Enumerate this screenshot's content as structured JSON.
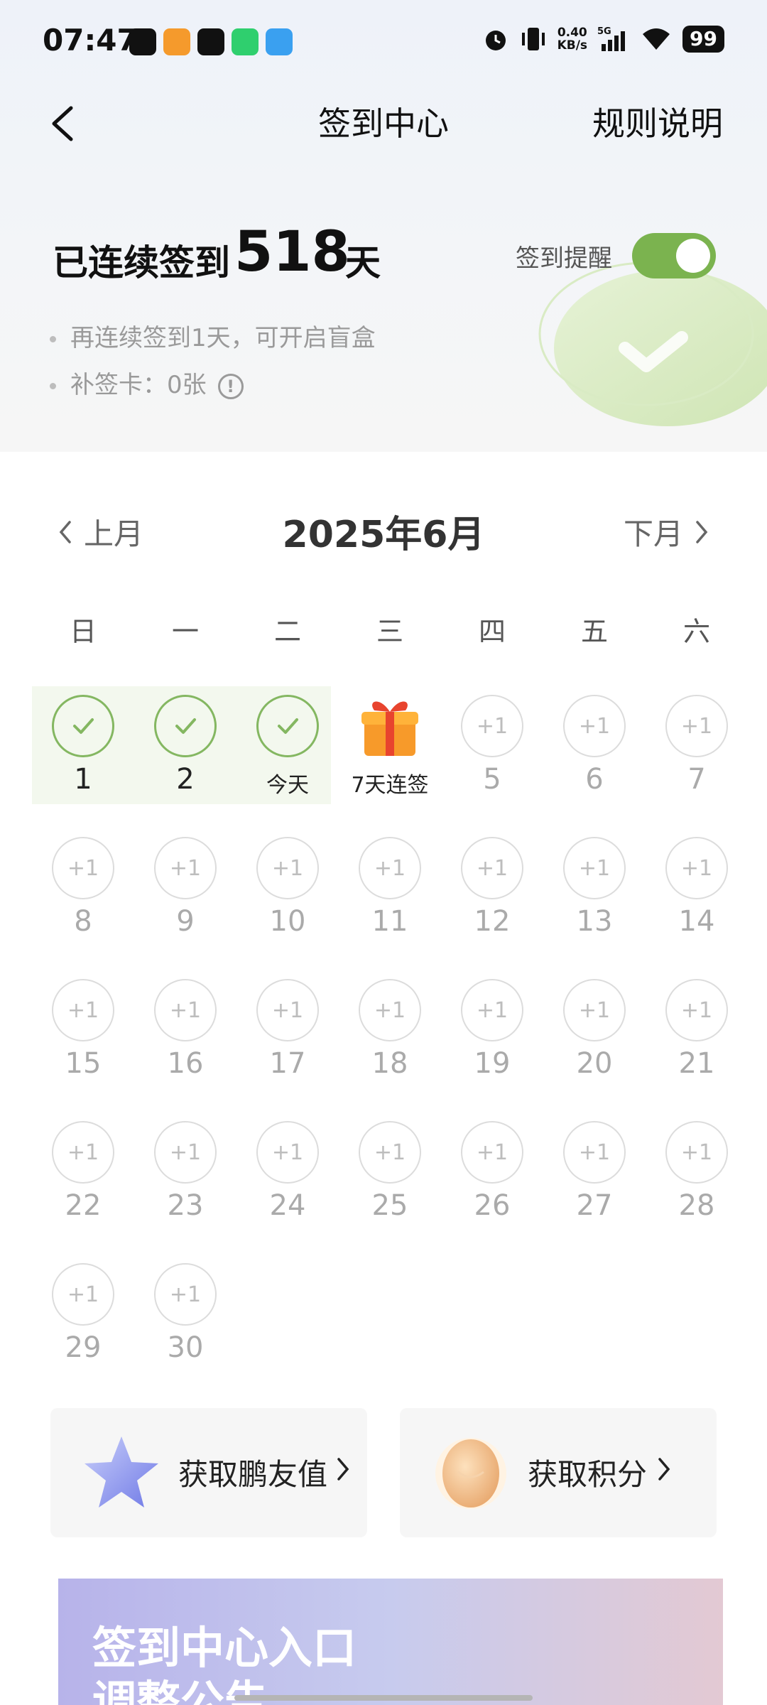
{
  "status_bar": {
    "time": "07:47",
    "net_speed_value": "0.40",
    "net_speed_unit": "KB/s",
    "network": "5G",
    "battery": "99"
  },
  "nav": {
    "title": "签到中心",
    "rules_label": "规则说明"
  },
  "summary": {
    "streak_label": "已连续签到",
    "streak_days": "518",
    "streak_unit": "天",
    "reminder_label": "签到提醒",
    "reminder_on": true,
    "hint_next": "再连续签到1天，可开启盲盒",
    "hint_card": "补签卡：0张"
  },
  "calendar": {
    "prev_label": "上月",
    "month_title": "2025年6月",
    "next_label": "下月",
    "weekdays": [
      "日",
      "一",
      "二",
      "三",
      "四",
      "五",
      "六"
    ],
    "plus_label": "+1",
    "days": [
      {
        "label": "1",
        "state": "signed"
      },
      {
        "label": "2",
        "state": "signed"
      },
      {
        "label": "今天",
        "state": "signed-today"
      },
      {
        "label": "7天连签",
        "state": "gift"
      },
      {
        "label": "5",
        "state": "pending"
      },
      {
        "label": "6",
        "state": "pending"
      },
      {
        "label": "7",
        "state": "pending"
      },
      {
        "label": "8",
        "state": "pending"
      },
      {
        "label": "9",
        "state": "pending"
      },
      {
        "label": "10",
        "state": "pending"
      },
      {
        "label": "11",
        "state": "pending"
      },
      {
        "label": "12",
        "state": "pending"
      },
      {
        "label": "13",
        "state": "pending"
      },
      {
        "label": "14",
        "state": "pending"
      },
      {
        "label": "15",
        "state": "pending"
      },
      {
        "label": "16",
        "state": "pending"
      },
      {
        "label": "17",
        "state": "pending"
      },
      {
        "label": "18",
        "state": "pending"
      },
      {
        "label": "19",
        "state": "pending"
      },
      {
        "label": "20",
        "state": "pending"
      },
      {
        "label": "21",
        "state": "pending"
      },
      {
        "label": "22",
        "state": "pending"
      },
      {
        "label": "23",
        "state": "pending"
      },
      {
        "label": "24",
        "state": "pending"
      },
      {
        "label": "25",
        "state": "pending"
      },
      {
        "label": "26",
        "state": "pending"
      },
      {
        "label": "27",
        "state": "pending"
      },
      {
        "label": "28",
        "state": "pending"
      },
      {
        "label": "29",
        "state": "pending"
      },
      {
        "label": "30",
        "state": "pending"
      }
    ]
  },
  "actions": {
    "friend_value_label": "获取鹏友值",
    "points_label": "获取积分"
  },
  "banner": {
    "line1": "签到中心入口",
    "line2": "调整公告"
  },
  "colors": {
    "accent_green": "#7bb34f",
    "check_green": "#84b761",
    "streak_highlight": "#f3f8ee"
  }
}
